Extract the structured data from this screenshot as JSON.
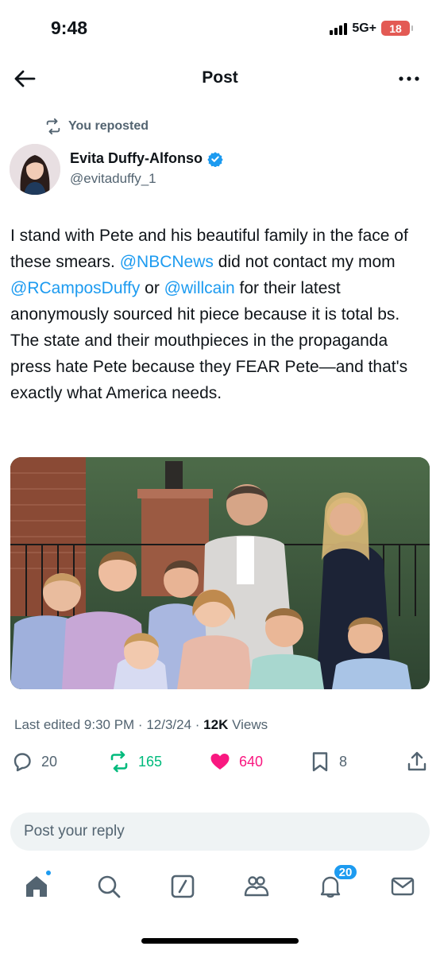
{
  "status_bar": {
    "time": "9:48",
    "network": "5G+",
    "battery": "18"
  },
  "header": {
    "title": "Post"
  },
  "repost": {
    "label": "You reposted"
  },
  "author": {
    "name": "Evita Duffy-Alfonso",
    "handle": "@evitaduffy_1",
    "verified": true
  },
  "tweet": {
    "text_1": "I stand with Pete and his beautiful family in the face of these smears. ",
    "mention_1": "@NBCNews",
    "text_2": " did not contact my mom ",
    "mention_2": "@RCamposDuffy",
    "text_3": " or ",
    "mention_3": "@willcain",
    "text_4": " for their latest anonymously sourced hit piece because it is total bs. The state and their mouthpieces in the propaganda press hate Pete because they FEAR Pete—and that's exactly what America needs."
  },
  "meta": {
    "edited": "Last edited 9:30 PM · 12/3/24 · ",
    "views_count": "12K",
    "views_label": " Views"
  },
  "actions": {
    "replies": "20",
    "reposts": "165",
    "likes": "640",
    "bookmarks": "8"
  },
  "reply": {
    "placeholder": "Post your reply"
  },
  "nav": {
    "notifications_badge": "20"
  },
  "colors": {
    "accent": "#1d9bf0",
    "repost": "#00ba7c",
    "like": "#f91880",
    "muted": "#536471"
  },
  "icons": [
    "back-arrow-icon",
    "more-icon",
    "repost-icon",
    "verified-icon",
    "reply-icon",
    "like-icon",
    "bookmark-icon",
    "share-icon",
    "home-icon",
    "search-icon",
    "grok-icon",
    "communities-icon",
    "notifications-icon",
    "messages-icon"
  ]
}
